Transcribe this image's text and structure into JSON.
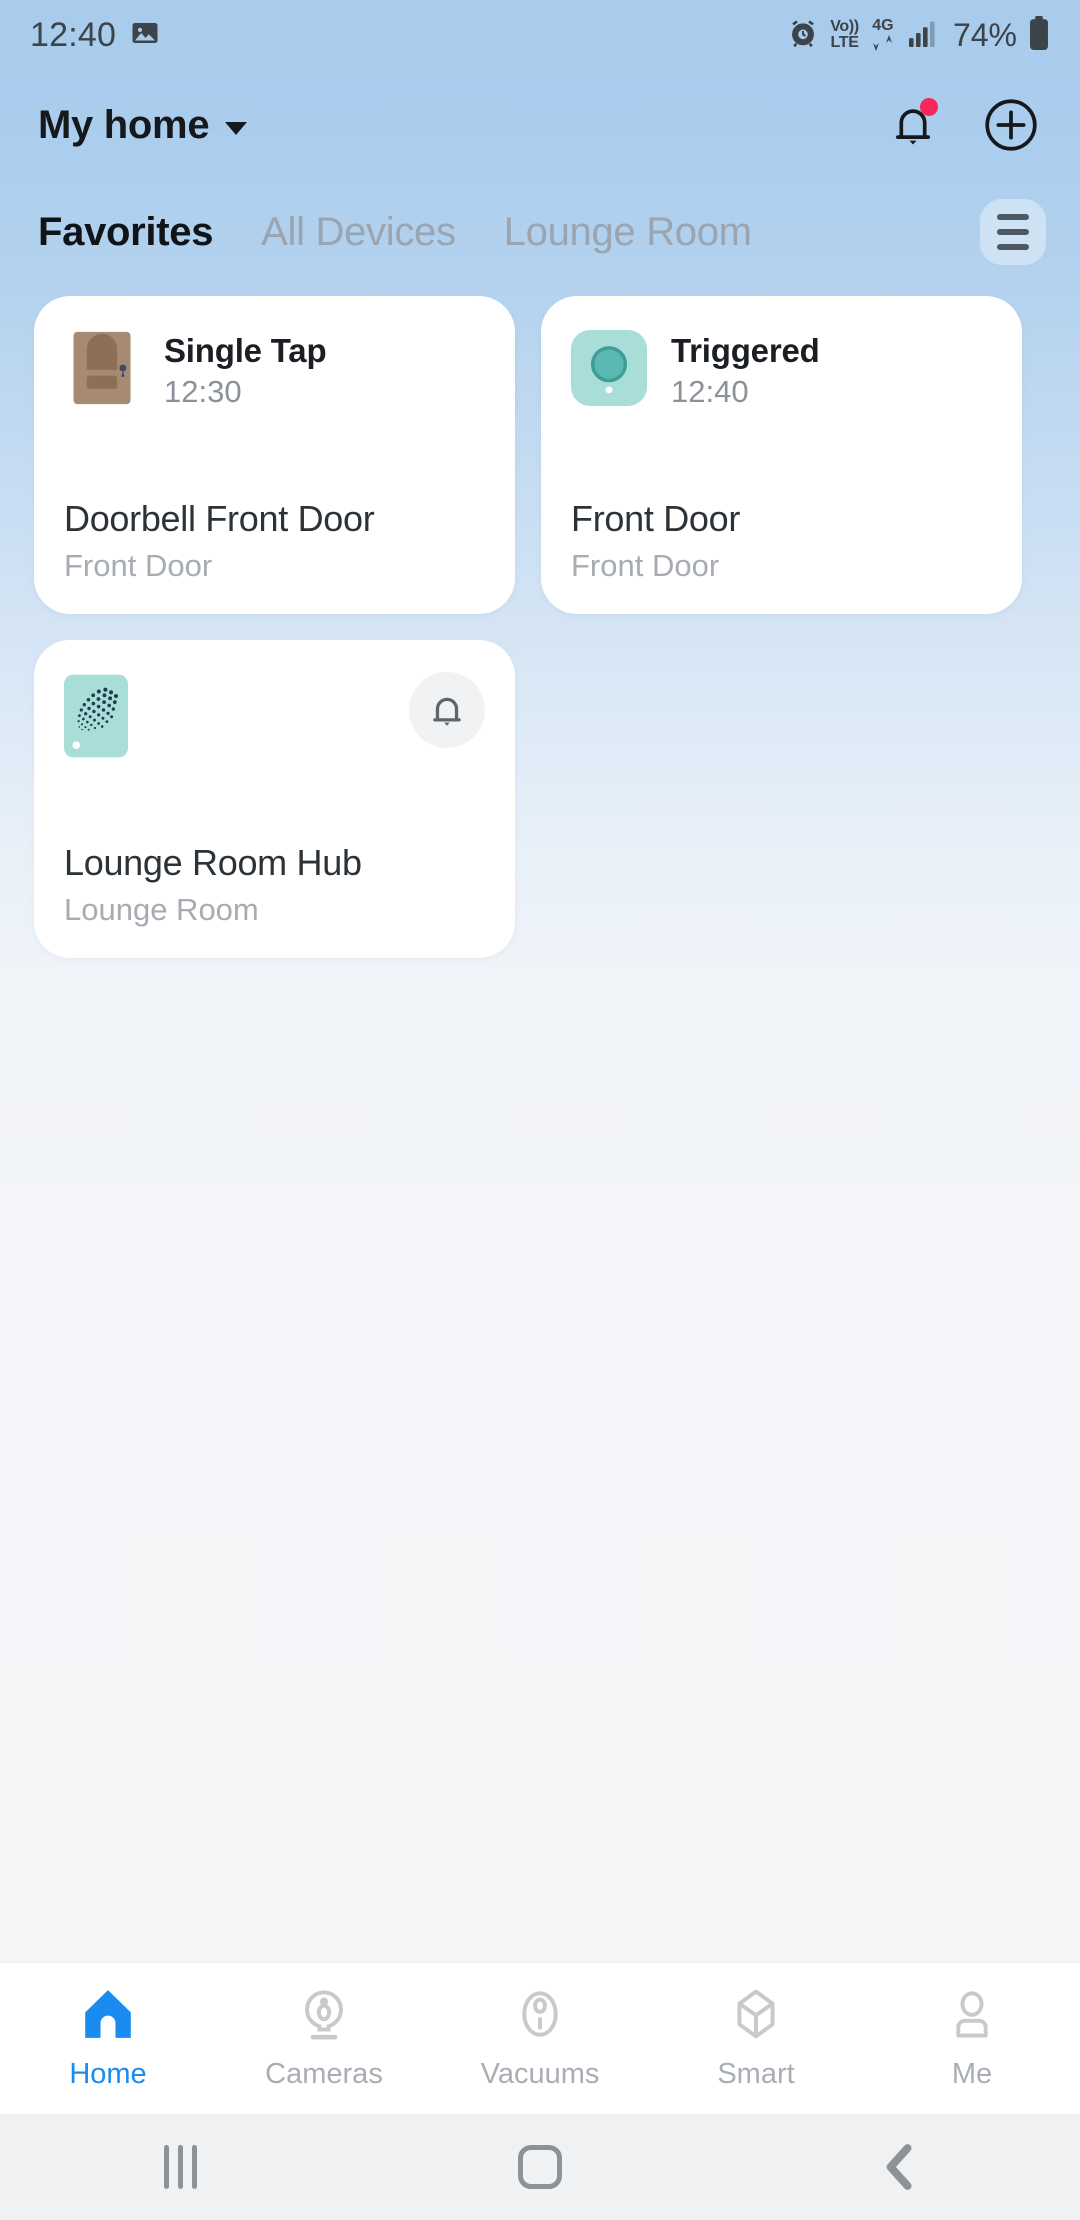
{
  "status_bar": {
    "clock": "12:40",
    "gallery_icon": "image-icon",
    "alarm_icon": "alarm-icon",
    "volte_top": "Vo))",
    "volte_bottom": "LTE",
    "network_type": "4G",
    "data_arrows": "data-transfer-icon",
    "signal_icon": "signal-bars-icon",
    "battery_percent": "74%",
    "battery_icon": "battery-icon"
  },
  "header": {
    "home_name": "My home",
    "dropdown_icon": "chevron-down-icon",
    "notifications_icon": "bell-icon",
    "has_notification_badge": true,
    "add_icon": "plus-circle-icon"
  },
  "tabs": {
    "items": [
      {
        "label": "Favorites",
        "active": true
      },
      {
        "label": "All Devices",
        "active": false
      },
      {
        "label": "Lounge Room",
        "active": false
      }
    ],
    "menu_icon": "hamburger-menu-icon"
  },
  "cards": [
    {
      "thumb_icon": "door-icon",
      "status_label": "Single Tap",
      "status_time": "12:30",
      "device_name": "Doorbell Front Door",
      "device_room": "Front Door",
      "has_bell_button": false
    },
    {
      "thumb_icon": "camera-sensor-icon",
      "status_label": "Triggered",
      "status_time": "12:40",
      "device_name": "Front Door",
      "device_room": "Front Door",
      "has_bell_button": false
    },
    {
      "thumb_icon": "hub-icon",
      "status_label": "",
      "status_time": "",
      "device_name": "Lounge Room Hub",
      "device_room": "Lounge Room",
      "has_bell_button": true,
      "bell_button_icon": "bell-icon"
    }
  ],
  "bottom_nav": {
    "items": [
      {
        "label": "Home",
        "icon": "home-icon",
        "active": true
      },
      {
        "label": "Cameras",
        "icon": "camera-icon",
        "active": false
      },
      {
        "label": "Vacuums",
        "icon": "vacuum-icon",
        "active": false
      },
      {
        "label": "Smart",
        "icon": "cube-icon",
        "active": false
      },
      {
        "label": "Me",
        "icon": "person-icon",
        "active": false
      }
    ]
  },
  "system_nav": {
    "recents_icon": "recents-icon",
    "home_icon": "home-square-icon",
    "back_icon": "back-chevron-icon"
  },
  "colors": {
    "accent": "#1a8cf0",
    "badge": "#f8285a",
    "mint": "#a5ddd7",
    "teal": "#4fb3ad",
    "card_bg": "#ffffff"
  }
}
